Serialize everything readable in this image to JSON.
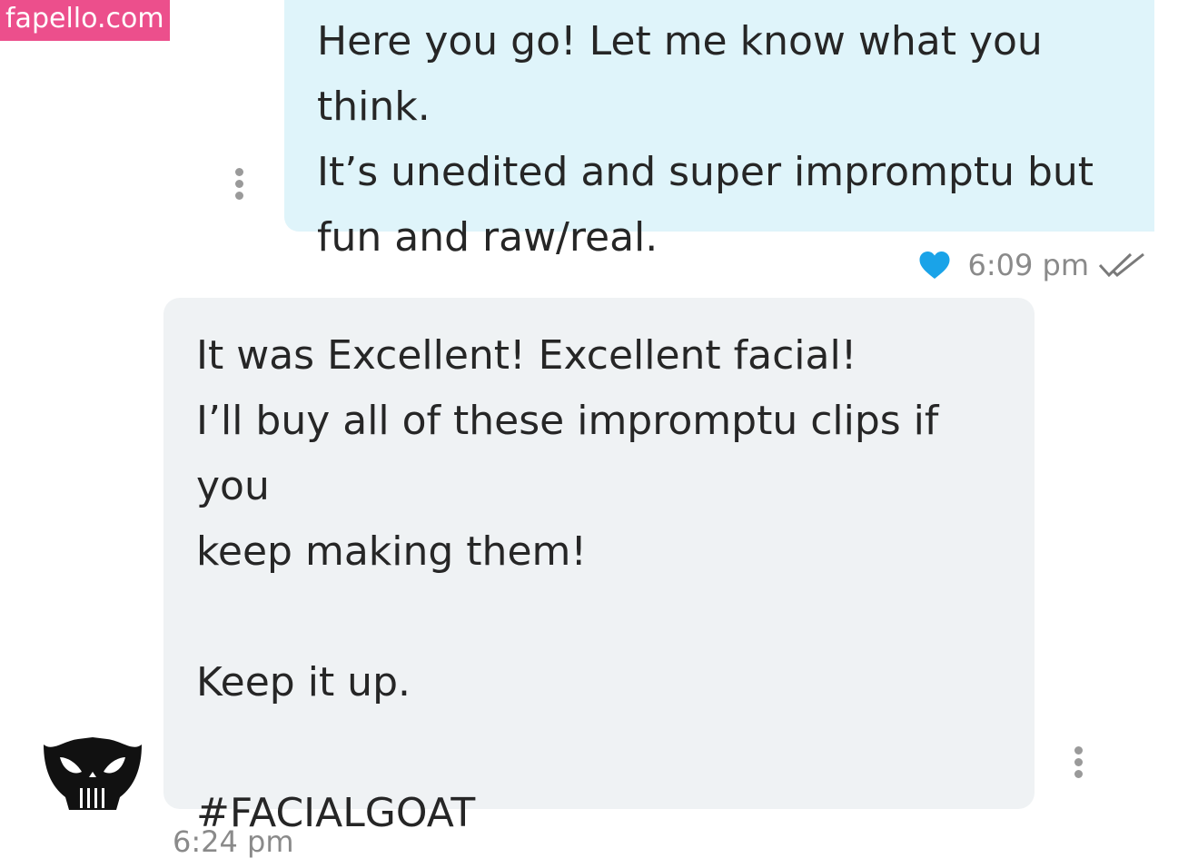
{
  "watermark": "fapello.com",
  "messages": {
    "sent": {
      "text": "Here you go! Let me know what you think.\nIt’s unedited and super impromptu but\nfun and raw/real.",
      "time": "6:09 pm",
      "reaction_icon": "heart-icon",
      "status_icon": "double-check-icon",
      "bubble_color": "#dff4fa"
    },
    "received": {
      "text": "It was Excellent! Excellent facial!\nI’ll buy all of these impromptu clips if you\nkeep making them!\n\nKeep it up.\n\n#FACIALGOAT",
      "time": "6:24 pm",
      "avatar_icon": "skull-avatar-icon",
      "bubble_color": "#eff2f4"
    }
  },
  "colors": {
    "heart": "#1aa3e8",
    "watermark_bg": "#ec4f8c",
    "timestamp": "#8a8a8a"
  }
}
